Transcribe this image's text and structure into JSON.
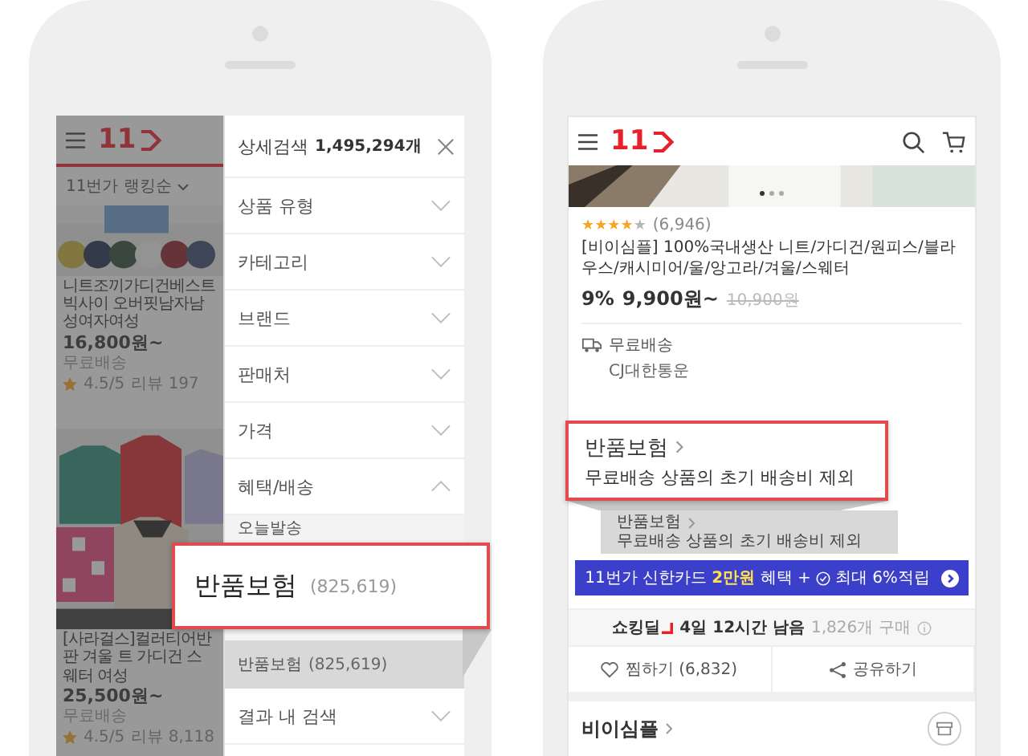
{
  "left_screen": {
    "logo_text": "11",
    "sort_label": "11번가 랭킹순",
    "products": [
      {
        "title": "니트조끼가디건베스트빅사이 오버핏남자남성여자여성",
        "price": "16,800원~",
        "shipping": "무료배송",
        "rating": "4.5/5",
        "reviews": "리뷰 197"
      },
      {
        "title": "[사라걸스]컬러티어반판 겨울 트 가디건 스웨터 여성",
        "price": "25,500원~",
        "shipping": "무료배송",
        "rating": "4.5/5",
        "reviews": "리뷰 8,118"
      }
    ],
    "filter_panel": {
      "title": "상세검색",
      "count": "1,495,294개",
      "sections": [
        {
          "label": "상품 유형",
          "expanded": false
        },
        {
          "label": "카테고리",
          "expanded": false
        },
        {
          "label": "브랜드",
          "expanded": false
        },
        {
          "label": "판매처",
          "expanded": false
        },
        {
          "label": "가격",
          "expanded": false
        },
        {
          "label": "혜택/배송",
          "expanded": true,
          "options": [
            {
              "label": "오늘발송"
            },
            {
              "label": "반품보험",
              "count": "(825,619)"
            }
          ]
        },
        {
          "label": "결과 내 검색",
          "expanded": false
        }
      ]
    }
  },
  "left_callout": {
    "label": "반품보험",
    "count": "(825,619)"
  },
  "right_screen": {
    "logo_text": "11",
    "stars": 4,
    "review_count": "(6,946)",
    "title": "[비이심플] 100%국내생산 니트/가디건/원피스/블라우스/캐시미어/울/앙고라/겨울/스웨터",
    "discount": "9%",
    "price": "9,900원~",
    "original_price": "10,900원",
    "delivery": {
      "label": "무료배송",
      "courier": "CJ대한통운"
    },
    "return_insurance": {
      "label": "반품보험",
      "note": "무료배송 상품의 초기 배송비 제외"
    },
    "card_banner": {
      "text": "11번가 신한카드 **2만원** 혜택 +",
      "extra": "최대 6%적립"
    },
    "deal": {
      "brand": "쇼킹딜",
      "remaining": "4일 12시간 남음",
      "sold": "1,826개 구매"
    },
    "actions": [
      {
        "label": "찜하기 (6,832)",
        "kind": "like"
      },
      {
        "label": "공유하기",
        "kind": "share"
      }
    ],
    "seller": "비이심플"
  },
  "right_callout": {
    "label": "반품보험",
    "note": "무료배송 상품의 초기 배송비 제외"
  }
}
